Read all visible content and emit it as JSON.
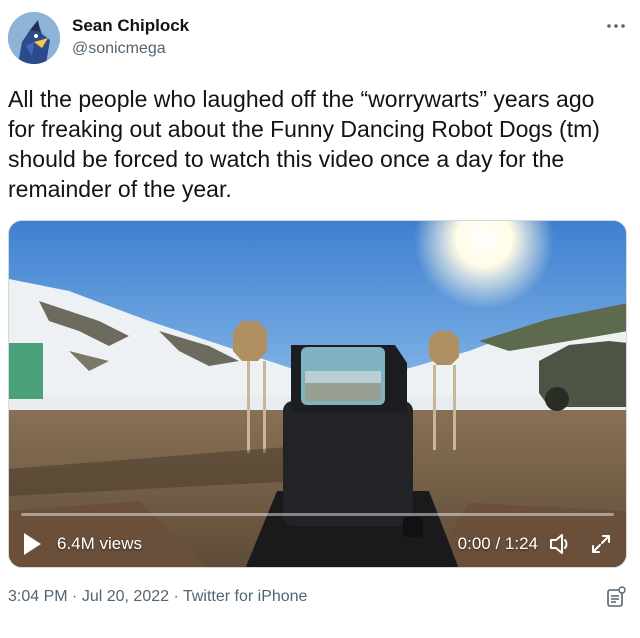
{
  "author": {
    "name": "Sean Chiplock",
    "handle": "@sonicmega"
  },
  "tweet": {
    "text": "All the people who laughed off the “worrywarts” years ago for freaking out about the Funny Dancing Robot Dogs (tm) should be forced to watch this video once a day for the remainder of the year."
  },
  "video": {
    "views": "6.4M views",
    "time": "0:00 / 1:24",
    "progress": 0.0
  },
  "meta": {
    "time": "3:04 PM",
    "separator": "·",
    "date": "Jul 20, 2022",
    "source": "Twitter for iPhone"
  },
  "icons": {
    "more": "more-horizontal-icon",
    "play": "play-icon",
    "volume": "volume-icon",
    "fullscreen": "fullscreen-icon",
    "analytics": "analytics-icon"
  },
  "colors": {
    "text_primary": "#0f1419",
    "text_secondary": "#536471",
    "border": "#cfd9de"
  }
}
